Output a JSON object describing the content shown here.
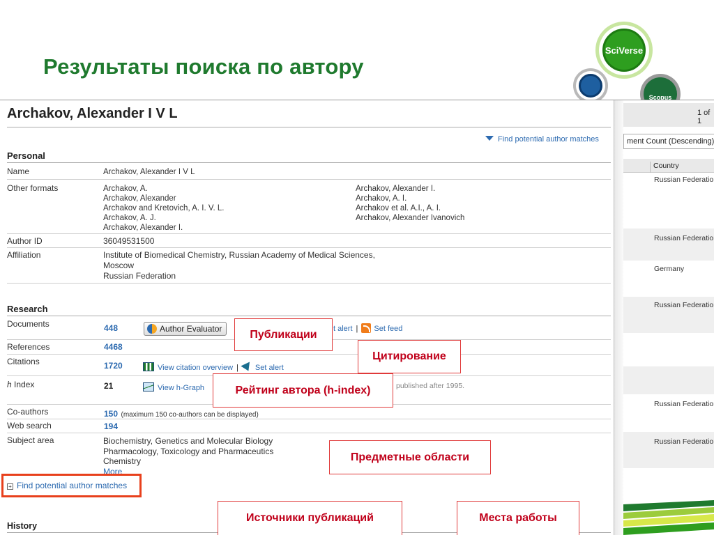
{
  "slide": {
    "title": "Результаты поиска по автору"
  },
  "logo": {
    "sciverse": "SciVerse",
    "scopus": "Scopus"
  },
  "author": {
    "name": "Archakov, Alexander I V L",
    "find_matches_top": "Find potential author matches"
  },
  "personal": {
    "heading": "Personal",
    "name_label": "Name",
    "name_value": "Archakov, Alexander I V L",
    "other_label": "Other formats",
    "other_col1": [
      "Archakov, A.",
      "Archakov, Alexander",
      "Archakov and Kretovich, A. I. V. L.",
      "Archakov, A. J.",
      "Archakov, Alexander I."
    ],
    "other_col2": [
      "Archakov, Alexander I.",
      "Archakov, A. I.",
      "Archakov et al. A.I., A. I.",
      "Archakov, Alexander Ivanovich"
    ],
    "author_id_label": "Author ID",
    "author_id_value": "36049531500",
    "affiliation_label": "Affiliation",
    "affiliation_lines": [
      "Institute of Biomedical Chemistry, Russian Academy of Medical Sciences,",
      "Moscow",
      "Russian Federation"
    ]
  },
  "research": {
    "heading": "Research",
    "documents_label": "Documents",
    "documents_value": "448",
    "author_evaluator": "Author Evaluator",
    "set_alert_partial": "t alert",
    "set_feed": "Set feed",
    "references_label": "References",
    "references_value": "4468",
    "citations_label": "Citations",
    "citations_value": "1720",
    "view_citation_overview": "View citation overview",
    "set_alert": "Set alert",
    "hindex_label_prefix": "h",
    "hindex_label_suffix": " Index",
    "hindex_value": "21",
    "view_hgraph": "View h-Graph",
    "published_after": "published after 1995.",
    "coauthors_label": "Co-authors",
    "coauthors_value": "150",
    "coauthors_note": "(maximum 150 co-authors can be displayed)",
    "websearch_label": "Web search",
    "websearch_value": "194",
    "subject_label": "Subject area",
    "subject_lines": [
      "Biochemistry, Genetics and Molecular Biology",
      "Pharmacology, Toxicology and Pharmaceutics",
      "Chemistry"
    ],
    "more": "More"
  },
  "find_matches_bottom": "Find potential author matches",
  "history": {
    "heading": "History"
  },
  "annotations": {
    "publications": "Публикации",
    "citations": "Цитирование",
    "hindex": "Рейтинг автора (h-index)",
    "subjects": "Предметные области",
    "sources": "Источники публикаций",
    "workplaces": "Места работы"
  },
  "right_panel": {
    "page": "1 of 1",
    "sort": "ment Count (Descending)",
    "country_header": "Country",
    "countries": [
      "Russian Federation",
      "Russian Federation",
      "Germany",
      "Russian Federation",
      "Russian Federation",
      "Russian Federation"
    ]
  },
  "colors": {
    "title_green": "#1f7a2e",
    "link_blue": "#2c6ab0",
    "annotation_red": "#e03a3a"
  }
}
